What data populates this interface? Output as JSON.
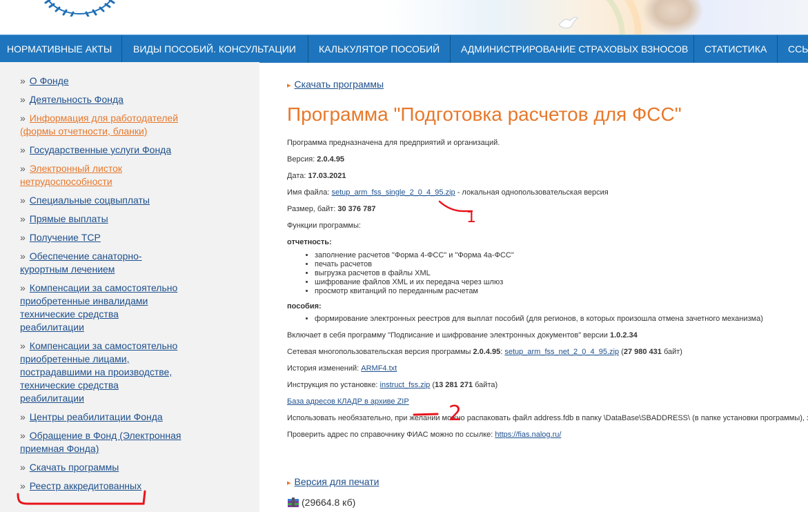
{
  "nav": {
    "items": [
      "НОРМАТИВНЫЕ АКТЫ",
      "ВИДЫ ПОСОБИЙ. КОНСУЛЬТАЦИИ",
      "КАЛЬКУЛЯТОР ПОСОБИЙ",
      "АДМИНИСТРИРОВАНИЕ СТРАХОВЫХ ВЗНОСОВ",
      "СТАТИСТИКА",
      "ССЫ"
    ]
  },
  "sidebar": {
    "bullet": "»",
    "items": [
      "О Фонде",
      "Деятельность Фонда",
      "Информация для работодателей (формы отчетности, бланки)",
      "Государственные услуги Фонда",
      "Электронный листок нетрудоспособности",
      "Специальные соцвыплаты",
      "Прямые выплаты",
      "Получение ТСР",
      "Обеспечение санаторно-курортным лечением",
      "Компенсации за самостоятельно приобретенные инвалидами технические средства реабилитации",
      "Компенсации за самостоятельно приобретенные лицами, пострадавшими на производстве, технические средства реабилитации",
      "Центры реабилитации Фонда",
      "Обращение в Фонд (Электронная приемная Фонда)",
      "Скачать программы",
      "Реестр аккредитованных"
    ]
  },
  "content": {
    "breadcrumb": "Скачать программы",
    "title": "Программа \"Подготовка расчетов для ФСС\"",
    "intro": "Программа предназначена для предприятий и организаций.",
    "version_label": "Версия: ",
    "version": "2.0.4.95",
    "date_label": "Дата: ",
    "date": "17.03.2021",
    "filename_label": "Имя файла: ",
    "filename": "setup_arm_fss_single_2_0_4_95.zip",
    "filename_suffix": " - локальная однопользовательская версия",
    "size_label": "Размер, байт: ",
    "size": "30 376 787",
    "functions_label": "Функции программы:",
    "reporting_label": "отчетность:",
    "reporting_items": [
      "заполнение расчетов \"Форма 4-ФСС\" и \"Форма 4а-ФСС\"",
      "печать расчетов",
      "выгрузка расчетов в файлы XML",
      "шифрование файлов XML и их передача через шлюз",
      "просмотр квитанций по переданным расчетам"
    ],
    "benefits_label": "пособия:",
    "benefits_items": [
      "формирование электронных реестров для выплат пособий (для регионов, в которых произошла отмена зачетного механизма)"
    ],
    "includes_text": "Включает в себя программу \"Подписание и шифрование электронных документов\" версии ",
    "includes_version": "1.0.2.34",
    "net_text": "Сетевая многопользовательская версия программы ",
    "net_version": "2.0.4.95",
    "net_colon": ": ",
    "net_file": "setup_arm_fss_net_2_0_4_95.zip",
    "net_size_open": " (",
    "net_size": "27 980 431",
    "net_size_close": " байт)",
    "history_label": "История изменений: ",
    "history_file": "ARMF4.txt",
    "install_label": "Инструкция по установке: ",
    "install_file": "instruct_fss.zip",
    "install_size_open": " (",
    "install_size": "13 281 271",
    "install_size_close": " байта)",
    "kladr_link": "База адресов КЛАДР в архиве ZIP",
    "optional_text": "Использовать необязательно, при желании можно распаковать файл address.fdb в папку \\DataBase\\SBADDRESS\\ (в папке установки программы), за",
    "fias_text": "Проверить адрес по справочнику ФИАС можно по ссылке: ",
    "fias_link": "https://fias.nalog.ru/",
    "print_link": "Версия для печати",
    "archive_size": "(29664.8 кб)"
  },
  "annotations": {
    "mark1": "1",
    "mark2": "2",
    "color": "#e8131b"
  },
  "colors": {
    "nav_bg": "#1e75bd",
    "accent_orange": "#e7782b",
    "link_blue": "#1d4f8c",
    "sidebar_bg": "#f2f2f2"
  }
}
